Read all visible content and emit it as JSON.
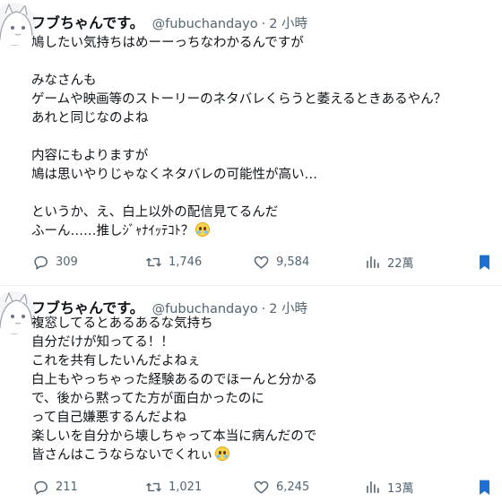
{
  "tweets": [
    {
      "author_name": "フブちゃんです。",
      "handle": "@fubuchandayo",
      "separator": "·",
      "time": "2 小時",
      "lines": [
        "鳩したい気持ちはめーーっちなわかるんですが",
        "",
        "みなさんも",
        "ゲームや映画等のストーリーのネタバレくらうと萎えるときあるやん？",
        "あれと同じなのよね",
        "",
        "内容にもよりますが",
        "鳩は思いやりじゃなくネタバレの可能性が高い…",
        "",
        "というか、え、白上以外の配信見てるんだ",
        "ふーん……推しｼﾞｬﾅｲｯﾃｺﾄ？"
      ],
      "replies": "309",
      "retweets": "1,746",
      "likes": "9,584",
      "views": "22萬"
    },
    {
      "author_name": "フブちゃんです。",
      "handle": "@fubuchandayo",
      "separator": "·",
      "time": "2 小時",
      "lines": [
        "複窓してるとあるあるな気持ち",
        "自分だけが知ってる！！",
        "これを共有したいんだよねぇ",
        "白上もやっちゃった経験あるのでほーんと分かる",
        "で、後から黙ってた方が面白かったのに",
        "って自己嫌悪するんだよね",
        "楽しいを自分から壊しちゃって本当に病んだので",
        "皆さんはこうならないでくれぃ"
      ],
      "replies": "211",
      "retweets": "1,021",
      "likes": "6,245",
      "views": "13萬"
    }
  ],
  "icons": {
    "reply": "speech-bubble-icon",
    "retweet": "retweet-arrows-icon",
    "like": "heart-icon",
    "views": "bar-chart-icon",
    "bookmark": "bookmark-icon"
  },
  "colors": {
    "text": "#0f1419",
    "secondary": "#536471",
    "bookmark_accent": "#1d6fd1",
    "divider": "#eff3f4"
  }
}
